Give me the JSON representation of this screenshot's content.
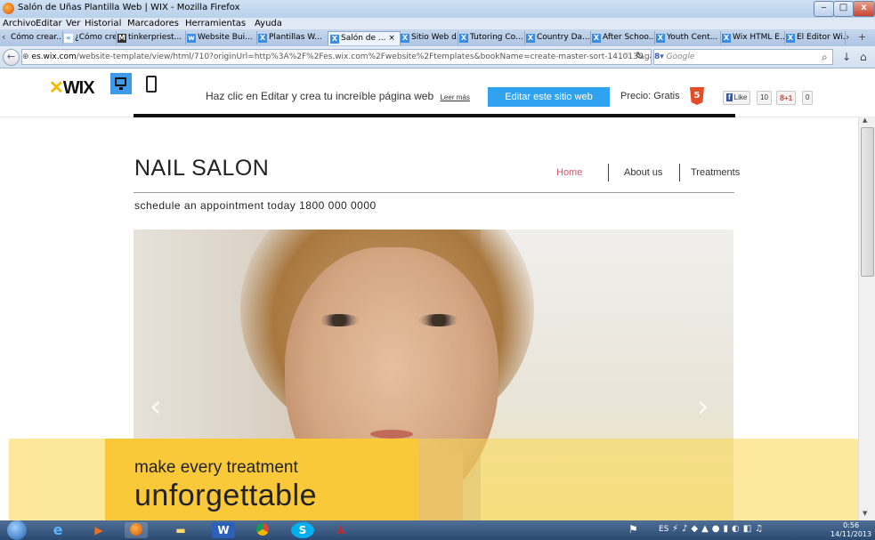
{
  "window": {
    "title": "Salón de Uñas Plantilla Web | WIX - Mozilla Firefox",
    "buttons": {
      "minimize": "‒",
      "maximize": "□",
      "close": "x"
    }
  },
  "menu": [
    "Archivo",
    "Editar",
    "Ver",
    "Historial",
    "Marcadores",
    "Herramientas",
    "Ayuda"
  ],
  "tabs": [
    "Cómo crear...",
    "¿Cómo crea...",
    "tinkerpriest...",
    "Website Bui...",
    "Plantillas W...",
    "Salón de ...",
    "Sitio Web d...",
    "Tutoring Co...",
    "Country Da...",
    "After Schoo...",
    "Youth Cent...",
    "Wix HTML E...",
    "El Editor Wi..."
  ],
  "address": {
    "domain": "es.wix.com",
    "path": "/website-template/view/html/710?originUrl=http%3A%2F%2Fes.wix.com%2Fwebsite%2Ftemplates&bookName=create-master-sort-141013&galleryDocInd",
    "search_placeholder": "Google"
  },
  "wixbar": {
    "logo": "WIX",
    "message": "Haz clic en Editar y crea tu increíble página web",
    "learn_more": "Leer más",
    "edit_button": "Editar este sitio web",
    "price": "Precio: Gratis",
    "html5_badge": "5",
    "fb_like": "Like",
    "fb_count": "10",
    "gplus": "+1",
    "gplus_count": "0"
  },
  "site": {
    "title": "NAIL SALON",
    "nav": [
      "Home",
      "About us",
      "Treatments"
    ],
    "nav_active_color": "#e0506b",
    "schedule": "schedule an appointment today 1800 000 0000",
    "tagline_small": "make every treatment",
    "tagline_large": "unforgettable",
    "prev_arrow": "‹",
    "next_arrow": "›"
  },
  "taskbar": {
    "lang": "ES",
    "time": "0:56",
    "date": "14/11/2013"
  }
}
